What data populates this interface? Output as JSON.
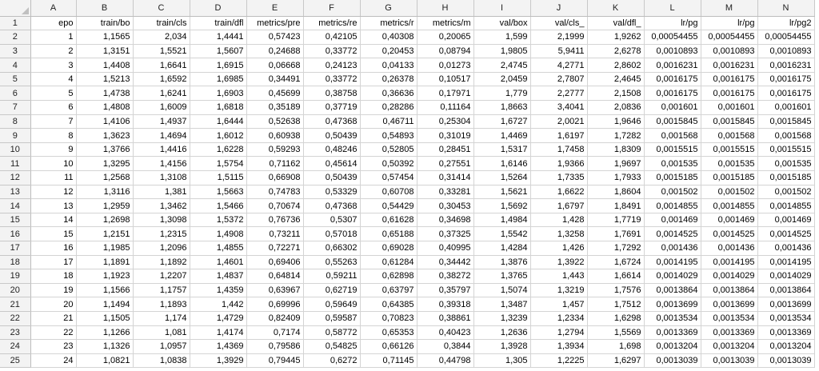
{
  "columns": [
    "A",
    "B",
    "C",
    "D",
    "E",
    "F",
    "G",
    "H",
    "I",
    "J",
    "K",
    "L",
    "M",
    "N"
  ],
  "rows": [
    [
      "epo",
      "train/bo",
      "train/cls",
      "train/dfl",
      "metrics/pre",
      "metrics/re",
      "metrics/r",
      "metrics/m",
      "val/box",
      "val/cls_",
      "val/dfl_",
      "lr/pg",
      "lr/pg",
      "lr/pg2"
    ],
    [
      "1",
      "1,1565",
      "2,034",
      "1,4441",
      "0,57423",
      "0,42105",
      "0,40308",
      "0,20065",
      "1,599",
      "2,1999",
      "1,9262",
      "0,00054455",
      "0,00054455",
      "0,00054455"
    ],
    [
      "2",
      "1,3151",
      "1,5521",
      "1,5607",
      "0,24688",
      "0,33772",
      "0,20453",
      "0,08794",
      "1,9805",
      "5,9411",
      "2,6278",
      "0,0010893",
      "0,0010893",
      "0,0010893"
    ],
    [
      "3",
      "1,4408",
      "1,6641",
      "1,6915",
      "0,06668",
      "0,24123",
      "0,04133",
      "0,01273",
      "2,4745",
      "4,2771",
      "2,8602",
      "0,0016231",
      "0,0016231",
      "0,0016231"
    ],
    [
      "4",
      "1,5213",
      "1,6592",
      "1,6985",
      "0,34491",
      "0,33772",
      "0,26378",
      "0,10517",
      "2,0459",
      "2,7807",
      "2,4645",
      "0,0016175",
      "0,0016175",
      "0,0016175"
    ],
    [
      "5",
      "1,4738",
      "1,6241",
      "1,6903",
      "0,45699",
      "0,38758",
      "0,36636",
      "0,17971",
      "1,779",
      "2,2777",
      "2,1508",
      "0,0016175",
      "0,0016175",
      "0,0016175"
    ],
    [
      "6",
      "1,4808",
      "1,6009",
      "1,6818",
      "0,35189",
      "0,37719",
      "0,28286",
      "0,11164",
      "1,8663",
      "3,4041",
      "2,0836",
      "0,001601",
      "0,001601",
      "0,001601"
    ],
    [
      "7",
      "1,4106",
      "1,4937",
      "1,6444",
      "0,52638",
      "0,47368",
      "0,46711",
      "0,25304",
      "1,6727",
      "2,0021",
      "1,9646",
      "0,0015845",
      "0,0015845",
      "0,0015845"
    ],
    [
      "8",
      "1,3623",
      "1,4694",
      "1,6012",
      "0,60938",
      "0,50439",
      "0,54893",
      "0,31019",
      "1,4469",
      "1,6197",
      "1,7282",
      "0,001568",
      "0,001568",
      "0,001568"
    ],
    [
      "9",
      "1,3766",
      "1,4416",
      "1,6228",
      "0,59293",
      "0,48246",
      "0,52805",
      "0,28451",
      "1,5317",
      "1,7458",
      "1,8309",
      "0,0015515",
      "0,0015515",
      "0,0015515"
    ],
    [
      "10",
      "1,3295",
      "1,4156",
      "1,5754",
      "0,71162",
      "0,45614",
      "0,50392",
      "0,27551",
      "1,6146",
      "1,9366",
      "1,9697",
      "0,001535",
      "0,001535",
      "0,001535"
    ],
    [
      "11",
      "1,2568",
      "1,3108",
      "1,5115",
      "0,66908",
      "0,50439",
      "0,57454",
      "0,31414",
      "1,5264",
      "1,7335",
      "1,7933",
      "0,0015185",
      "0,0015185",
      "0,0015185"
    ],
    [
      "12",
      "1,3116",
      "1,381",
      "1,5663",
      "0,74783",
      "0,53329",
      "0,60708",
      "0,33281",
      "1,5621",
      "1,6622",
      "1,8604",
      "0,001502",
      "0,001502",
      "0,001502"
    ],
    [
      "13",
      "1,2959",
      "1,3462",
      "1,5466",
      "0,70674",
      "0,47368",
      "0,54429",
      "0,30453",
      "1,5692",
      "1,6797",
      "1,8491",
      "0,0014855",
      "0,0014855",
      "0,0014855"
    ],
    [
      "14",
      "1,2698",
      "1,3098",
      "1,5372",
      "0,76736",
      "0,5307",
      "0,61628",
      "0,34698",
      "1,4984",
      "1,428",
      "1,7719",
      "0,001469",
      "0,001469",
      "0,001469"
    ],
    [
      "15",
      "1,2151",
      "1,2315",
      "1,4908",
      "0,73211",
      "0,57018",
      "0,65188",
      "0,37325",
      "1,5542",
      "1,3258",
      "1,7691",
      "0,0014525",
      "0,0014525",
      "0,0014525"
    ],
    [
      "16",
      "1,1985",
      "1,2096",
      "1,4855",
      "0,72271",
      "0,66302",
      "0,69028",
      "0,40995",
      "1,4284",
      "1,426",
      "1,7292",
      "0,001436",
      "0,001436",
      "0,001436"
    ],
    [
      "17",
      "1,1891",
      "1,1892",
      "1,4601",
      "0,69406",
      "0,55263",
      "0,61284",
      "0,34442",
      "1,3876",
      "1,3922",
      "1,6724",
      "0,0014195",
      "0,0014195",
      "0,0014195"
    ],
    [
      "18",
      "1,1923",
      "1,2207",
      "1,4837",
      "0,64814",
      "0,59211",
      "0,62898",
      "0,38272",
      "1,3765",
      "1,443",
      "1,6614",
      "0,0014029",
      "0,0014029",
      "0,0014029"
    ],
    [
      "19",
      "1,1566",
      "1,1757",
      "1,4359",
      "0,63967",
      "0,62719",
      "0,63797",
      "0,35797",
      "1,5074",
      "1,3219",
      "1,7576",
      "0,0013864",
      "0,0013864",
      "0,0013864"
    ],
    [
      "20",
      "1,1494",
      "1,1893",
      "1,442",
      "0,69996",
      "0,59649",
      "0,64385",
      "0,39318",
      "1,3487",
      "1,457",
      "1,7512",
      "0,0013699",
      "0,0013699",
      "0,0013699"
    ],
    [
      "21",
      "1,1505",
      "1,174",
      "1,4729",
      "0,82409",
      "0,59587",
      "0,70823",
      "0,38861",
      "1,3239",
      "1,2334",
      "1,6298",
      "0,0013534",
      "0,0013534",
      "0,0013534"
    ],
    [
      "22",
      "1,1266",
      "1,081",
      "1,4174",
      "0,7174",
      "0,58772",
      "0,65353",
      "0,40423",
      "1,2636",
      "1,2794",
      "1,5569",
      "0,0013369",
      "0,0013369",
      "0,0013369"
    ],
    [
      "23",
      "1,1326",
      "1,0957",
      "1,4369",
      "0,79586",
      "0,54825",
      "0,66126",
      "0,3844",
      "1,3928",
      "1,3934",
      "1,698",
      "0,0013204",
      "0,0013204",
      "0,0013204"
    ],
    [
      "24",
      "1,0821",
      "1,0838",
      "1,3929",
      "0,79445",
      "0,6272",
      "0,71145",
      "0,44798",
      "1,305",
      "1,2225",
      "1,6297",
      "0,0013039",
      "0,0013039",
      "0,0013039"
    ]
  ]
}
